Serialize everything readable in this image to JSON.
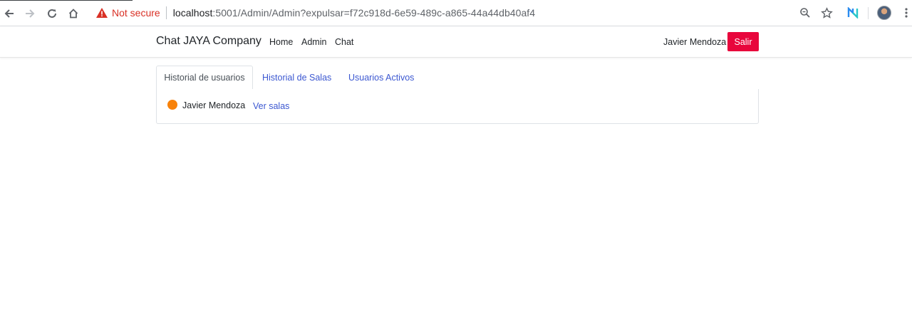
{
  "browser": {
    "security_label": "Not secure",
    "url_host": "localhost",
    "url_rest": ":5001/Admin/Admin?expulsar=f72c918d-6e59-489c-a865-44a44db40af4",
    "icons": [
      "back-arrow-icon",
      "forward-arrow-icon",
      "reload-icon",
      "home-icon",
      "warning-icon",
      "zoom-icon",
      "star-icon",
      "extension-icon",
      "profile-avatar",
      "menu-dots-icon"
    ]
  },
  "navbar": {
    "brand": "Chat JAYA Company",
    "links": [
      "Home",
      "Admin",
      "Chat"
    ],
    "user": "Javier Mendoza",
    "logout_label": "Salir",
    "logout_color": "#e8063c"
  },
  "tabs": {
    "items": [
      "Historial de usuarios",
      "Historial de Salas",
      "Usuarios Activos"
    ],
    "active_index": 0
  },
  "panel": {
    "rows": [
      {
        "user": "Javier Mendoza",
        "action": "Ver salas",
        "status_color": "#f8820a"
      }
    ]
  }
}
